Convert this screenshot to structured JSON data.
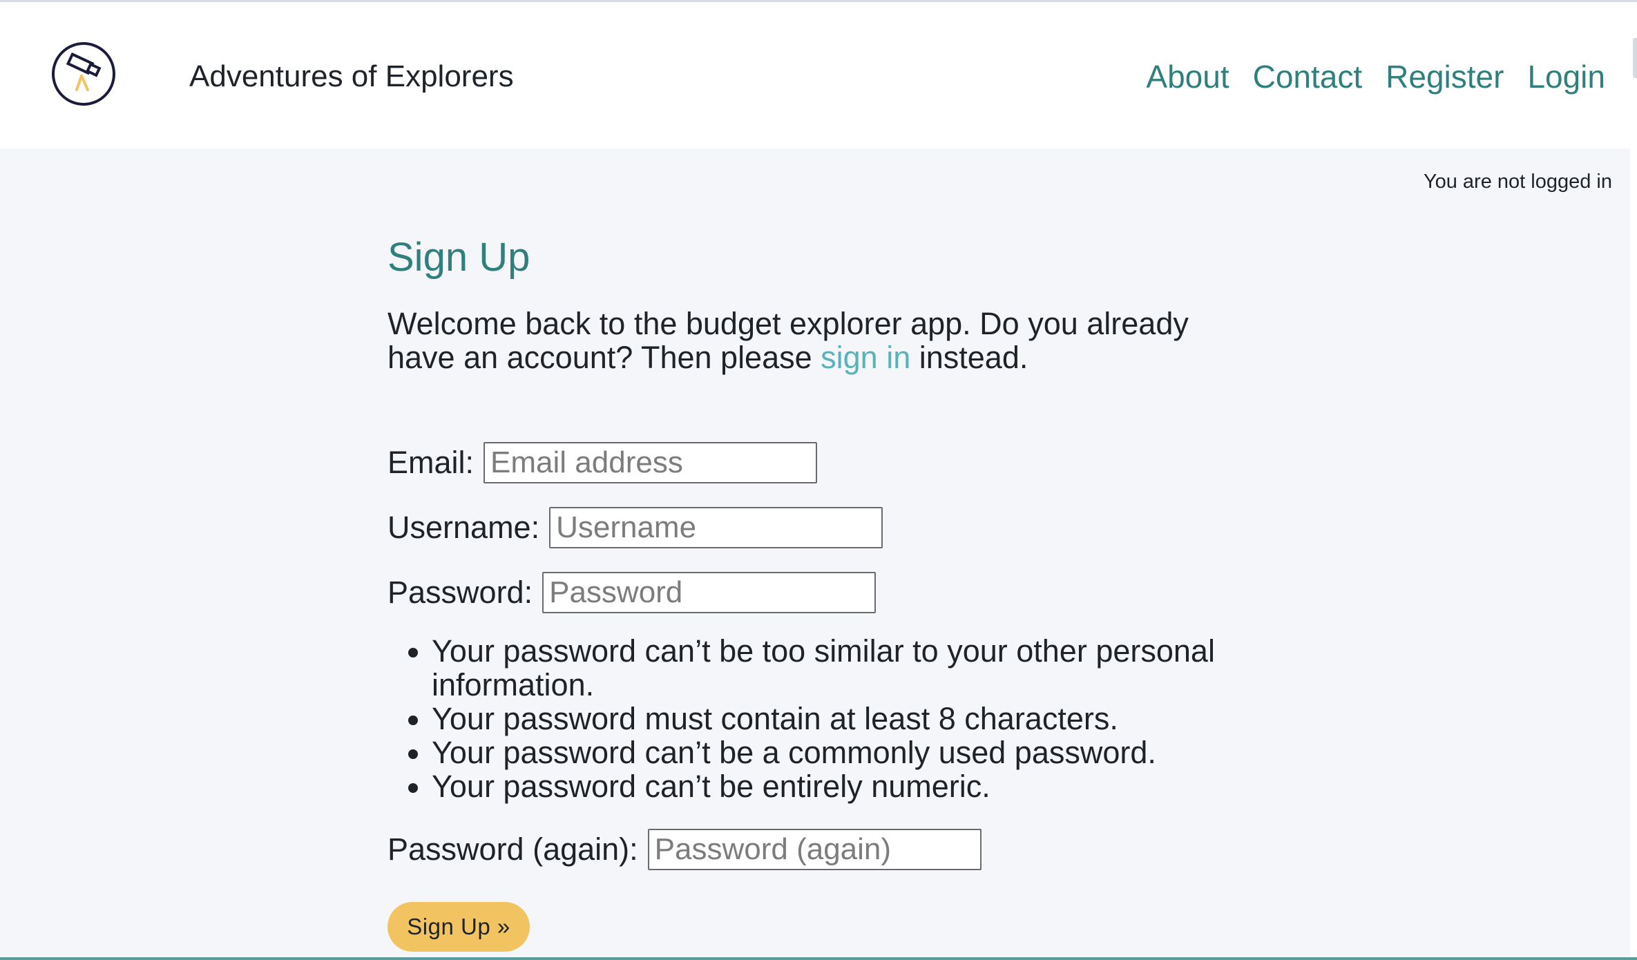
{
  "header": {
    "brand": "Adventures of Explorers",
    "nav": [
      "About",
      "Contact",
      "Register",
      "Login"
    ]
  },
  "status": "You are not logged in",
  "page": {
    "title": "Sign Up",
    "intro_before": "Welcome back to the budget explorer app. Do you already have an account? Then please ",
    "intro_link": "sign in",
    "intro_after": " instead."
  },
  "form": {
    "email": {
      "label": "Email:",
      "placeholder": "Email address",
      "value": ""
    },
    "username": {
      "label": "Username:",
      "placeholder": "Username",
      "value": ""
    },
    "password": {
      "label": "Password:",
      "placeholder": "Password",
      "value": ""
    },
    "password_rules": [
      "Your password can’t be too similar to your other personal information.",
      "Your password must contain at least 8 characters.",
      "Your password can’t be a commonly used password.",
      "Your password can’t be entirely numeric."
    ],
    "password_again": {
      "label": "Password (again):",
      "placeholder": "Password (again)",
      "value": ""
    },
    "submit_label": "Sign Up »"
  },
  "icons": {
    "logo": "telescope-icon"
  },
  "colors": {
    "accent": "#2f7f7d",
    "link": "#57b3ba",
    "button": "#f1c461",
    "background": "#f4f6f9",
    "header": "#ffffff"
  }
}
